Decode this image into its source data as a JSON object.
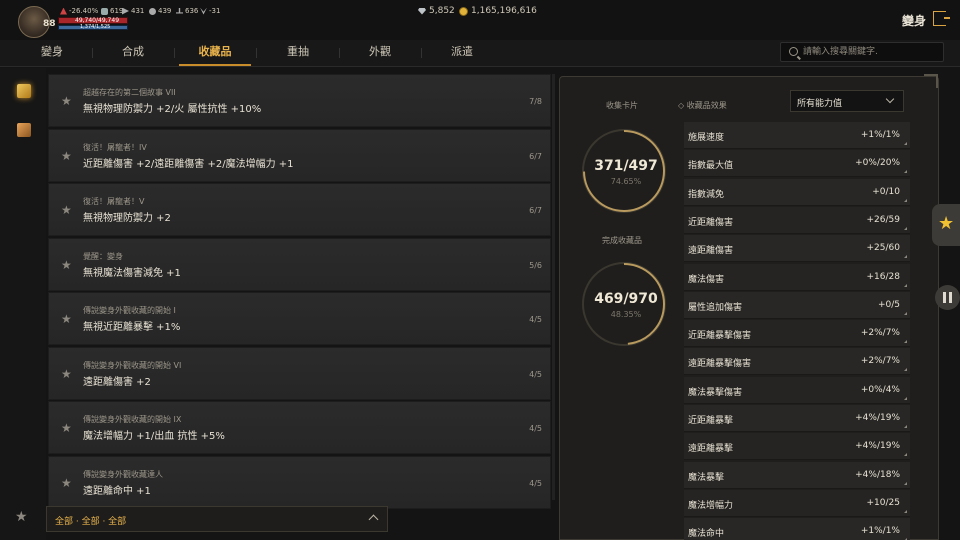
{
  "player": {
    "level": "88",
    "hp_text": "49,740/49,749",
    "mp_text": "1,374/1,525"
  },
  "stats_bar": [
    {
      "icon": "attack-icon",
      "value": "-26.40%"
    },
    {
      "icon": "defense-icon",
      "value": "619"
    },
    {
      "icon": "speed-icon",
      "value": "431"
    },
    {
      "icon": "weight-icon",
      "value": "439"
    },
    {
      "icon": "sword-icon",
      "value": "636"
    },
    {
      "icon": "wing-icon",
      "value": "-31"
    }
  ],
  "currency": {
    "diamond": "5,852",
    "gold": "1,165,196,616"
  },
  "header": {
    "title": "變身"
  },
  "tabs": [
    {
      "label": "變身"
    },
    {
      "label": "合成"
    },
    {
      "label": "收藏品",
      "active": true
    },
    {
      "label": "重抽"
    },
    {
      "label": "外觀"
    },
    {
      "label": "派遣"
    }
  ],
  "search": {
    "placeholder": "請輸入搜尋關鍵字."
  },
  "collections": [
    {
      "title": "超越存在的第二個故事 VII",
      "desc": "無視物理防禦力 +2/火 屬性抗性 +10%",
      "count": "7/8"
    },
    {
      "title": "復活！屠龍者！IV",
      "desc": "近距離傷害 +2/遠距離傷害 +2/魔法增幅力 +1",
      "count": "6/7"
    },
    {
      "title": "復活！屠龍者！V",
      "desc": "無視物理防禦力 +2",
      "count": "6/7"
    },
    {
      "title": "覺醒：變身",
      "desc": "無視魔法傷害減免 +1",
      "count": "5/6"
    },
    {
      "title": "傳說變身外觀收藏的開始 I",
      "desc": "無視近距離暴擊 +1%",
      "count": "4/5"
    },
    {
      "title": "傳說變身外觀收藏的開始 VI",
      "desc": "遠距離傷害 +2",
      "count": "4/5"
    },
    {
      "title": "傳說變身外觀收藏的開始 IX",
      "desc": "魔法增幅力 +1/出血 抗性 +5%",
      "count": "4/5"
    },
    {
      "title": "傳說變身外觀收藏達人",
      "desc": "遠距離命中 +1",
      "count": "4/5"
    }
  ],
  "filter": {
    "text": "全部 · 全部 · 全部"
  },
  "summary": {
    "cards_label": "收集卡片",
    "cards_value": "371",
    "cards_total": "/497",
    "cards_pct": "74.65%",
    "cards_fraction": 0.7465,
    "complete_label": "完成收藏品",
    "complete_value": "469",
    "complete_total": "/970",
    "complete_pct": "48.35%",
    "complete_fraction": 0.4835
  },
  "effects": {
    "label": "收藏品效果",
    "dropdown": "所有能力值",
    "rows": [
      {
        "name": "施展速度",
        "value": "+1%/1%"
      },
      {
        "name": "指數最大值",
        "value": "+0%/20%"
      },
      {
        "name": "指數減免",
        "value": "+0/10"
      },
      {
        "name": "近距離傷害",
        "value": "+26/59"
      },
      {
        "name": "遠距離傷害",
        "value": "+25/60"
      },
      {
        "name": "魔法傷害",
        "value": "+16/28"
      },
      {
        "name": "屬性追加傷害",
        "value": "+0/5"
      },
      {
        "name": "近距離暴擊傷害",
        "value": "+2%/7%"
      },
      {
        "name": "遠距離暴擊傷害",
        "value": "+2%/7%"
      },
      {
        "name": "魔法暴擊傷害",
        "value": "+0%/4%"
      },
      {
        "name": "近距離暴擊",
        "value": "+4%/19%"
      },
      {
        "name": "遠距離暴擊",
        "value": "+4%/19%"
      },
      {
        "name": "魔法暴擊",
        "value": "+4%/18%"
      },
      {
        "name": "魔法增幅力",
        "value": "+10/25"
      },
      {
        "name": "魔法命中",
        "value": "+1%/1%"
      }
    ]
  },
  "colors": {
    "accent": "#e8b34c",
    "hp": "#a8252a",
    "mp": "#3d6a9a",
    "fav": "#f1c232"
  }
}
